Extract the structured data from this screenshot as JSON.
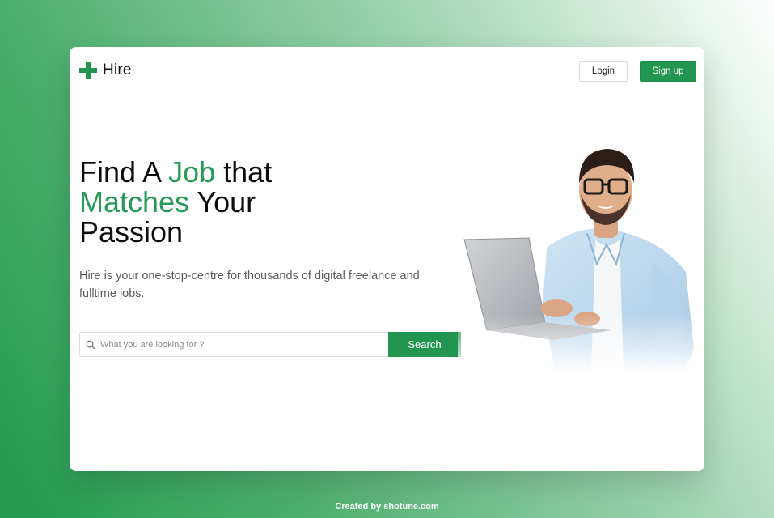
{
  "brand": {
    "name": "Hire",
    "icon": "plus-cross-icon",
    "color": "#229650"
  },
  "nav": {
    "login_label": "Login",
    "signup_label": "Sign up"
  },
  "hero": {
    "title_part1": "Find A ",
    "title_accent1": "Job",
    "title_part2": " that",
    "title_accent2": "Matches",
    "title_part3": " Your",
    "title_part4": "Passion",
    "subtitle": "Hire is your one-stop-centre for thousands of digital freelance and fulltime jobs."
  },
  "search": {
    "placeholder": "What you are looking for ?",
    "value": "",
    "button_label": "Search",
    "icon": "search-icon"
  },
  "hero_image": {
    "description": "man-with-laptop-photo"
  },
  "footer": {
    "credit": "Created by shotune.com"
  },
  "colors": {
    "accent": "#269b56",
    "button": "#229650"
  }
}
